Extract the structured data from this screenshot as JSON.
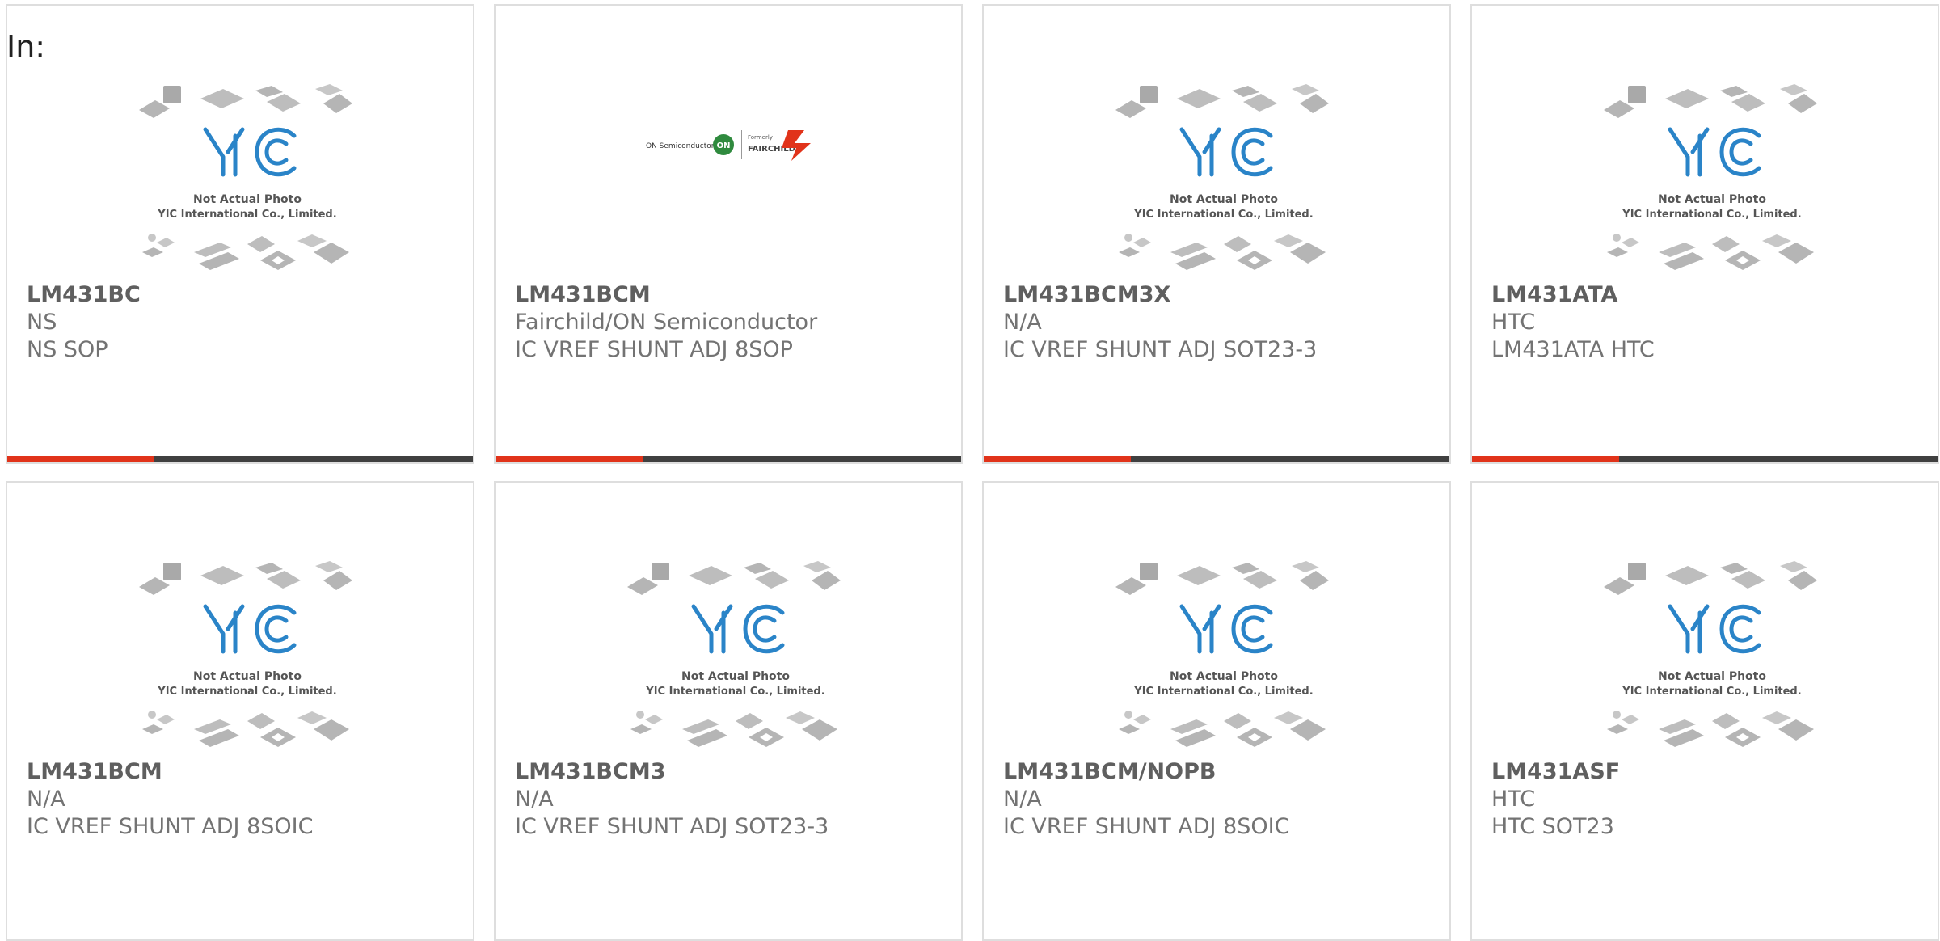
{
  "header": {
    "in_label": "In:"
  },
  "placeholder": {
    "line1": "Not Actual Photo",
    "line2": "YIC International Co., Limited.",
    "logo_text": "YIC"
  },
  "brand_logo": {
    "left_text": "ON Semiconductor",
    "on_text": "ON",
    "formerly_text": "Formerly",
    "fairchild_text": "FAIRCHILD"
  },
  "colors": {
    "accent": "#e1331a",
    "bar": "#404040",
    "logo_blue": "#2a84c8",
    "border": "#dedede"
  },
  "products": [
    {
      "part": "LM431BC",
      "manufacturer": "NS",
      "description": "NS SOP",
      "image": "placeholder"
    },
    {
      "part": "LM431BCM",
      "manufacturer": "Fairchild/ON Semiconductor",
      "description": "IC VREF SHUNT ADJ 8SOP",
      "image": "brand-logo"
    },
    {
      "part": "LM431BCM3X",
      "manufacturer": "N/A",
      "description": "IC VREF SHUNT ADJ SOT23-3",
      "image": "placeholder"
    },
    {
      "part": "LM431ATA",
      "manufacturer": "HTC",
      "description": "LM431ATA HTC",
      "image": "placeholder"
    },
    {
      "part": "LM431BCM",
      "manufacturer": "N/A",
      "description": "IC VREF SHUNT ADJ 8SOIC",
      "image": "placeholder"
    },
    {
      "part": "LM431BCM3",
      "manufacturer": "N/A",
      "description": "IC VREF SHUNT ADJ SOT23-3",
      "image": "placeholder"
    },
    {
      "part": "LM431BCM/NOPB",
      "manufacturer": "N/A",
      "description": "IC VREF SHUNT ADJ 8SOIC",
      "image": "placeholder"
    },
    {
      "part": "LM431ASF",
      "manufacturer": "HTC",
      "description": "HTC SOT23",
      "image": "placeholder"
    }
  ]
}
